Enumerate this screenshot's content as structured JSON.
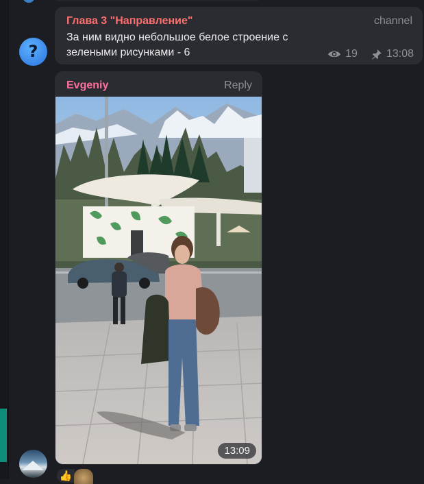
{
  "colors": {
    "background": "#1c1d22",
    "bubble": "#2b2c31",
    "channel_sender": "#ff6e6e",
    "user_sender": "#ff6f9b",
    "meta": "#8e9096",
    "accent": "#0d8d79"
  },
  "channel_message": {
    "sender": "Глава 3 \"Направление\"",
    "tag": "channel",
    "text": "За ним видно небольшое белое строение с зелеными рисунками - 6",
    "views": "19",
    "time": "13:08",
    "avatar_glyph": "?",
    "icons": [
      "eye-icon",
      "pin-icon"
    ]
  },
  "photo_message": {
    "sender": "Evgeniy",
    "reply_label": "Reply",
    "time": "13:09"
  },
  "reactions": {
    "thumb": "👍"
  }
}
